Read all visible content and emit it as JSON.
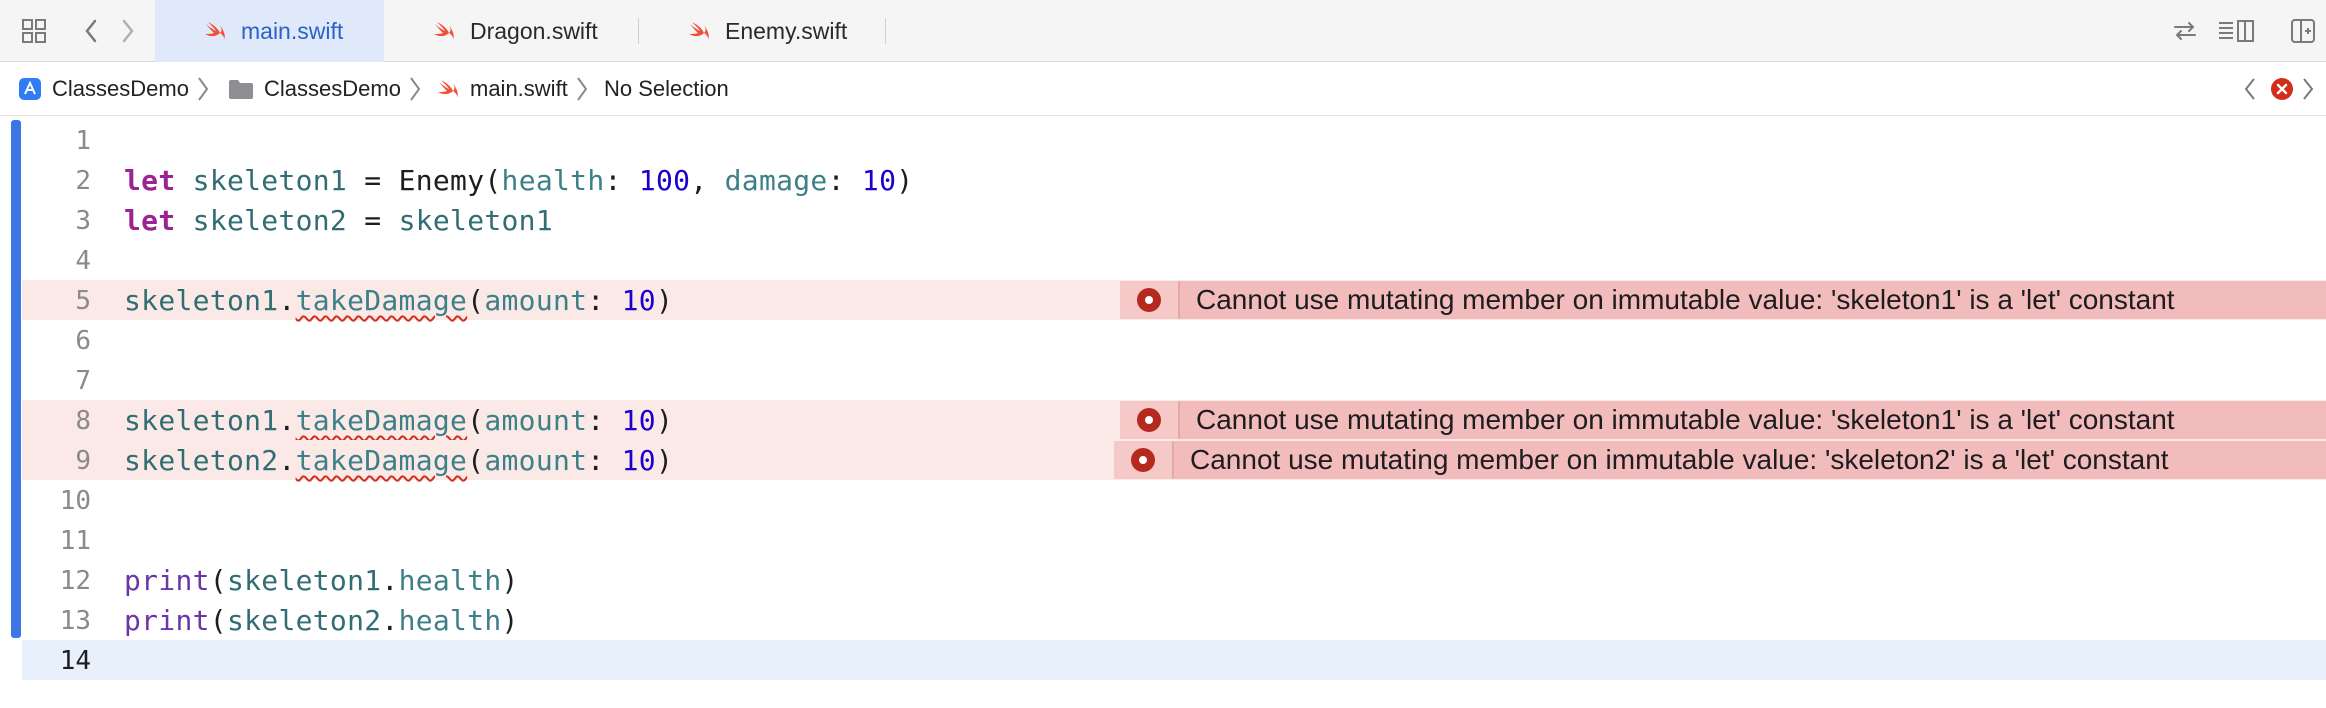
{
  "tabs": [
    {
      "label": "main.swift",
      "active": true
    },
    {
      "label": "Dragon.swift",
      "active": false
    },
    {
      "label": "Enemy.swift",
      "active": false
    }
  ],
  "breadcrumb": {
    "project": "ClassesDemo",
    "folder": "ClassesDemo",
    "file": "main.swift",
    "symbol": "No Selection"
  },
  "lines": [
    {
      "n": "1"
    },
    {
      "n": "2"
    },
    {
      "n": "3"
    },
    {
      "n": "4"
    },
    {
      "n": "5"
    },
    {
      "n": "6"
    },
    {
      "n": "7"
    },
    {
      "n": "8"
    },
    {
      "n": "9"
    },
    {
      "n": "10"
    },
    {
      "n": "11"
    },
    {
      "n": "12"
    },
    {
      "n": "13"
    },
    {
      "n": "14"
    }
  ],
  "code": {
    "l2": {
      "kw": "let",
      "name": "skeleton1",
      "eq": " = ",
      "type": "Enemy",
      "p1": "health",
      "v1": "100",
      "p2": "damage",
      "v2": "10"
    },
    "l3": {
      "kw": "let",
      "name": "skeleton2",
      "eq": " = ",
      "rhs": "skeleton1"
    },
    "l5": {
      "obj": "skeleton1",
      "method": "takeDamage",
      "arg": "amount",
      "val": "10"
    },
    "l8": {
      "obj": "skeleton1",
      "method": "takeDamage",
      "arg": "amount",
      "val": "10"
    },
    "l9": {
      "obj": "skeleton2",
      "method": "takeDamage",
      "arg": "amount",
      "val": "10"
    },
    "l12": {
      "fn": "print",
      "obj": "skeleton1",
      "prop": "health"
    },
    "l13": {
      "fn": "print",
      "obj": "skeleton2",
      "prop": "health"
    }
  },
  "errors": {
    "e5": "Cannot use mutating member on immutable value: 'skeleton1' is a 'let' constant",
    "e8": "Cannot use mutating member on immutable value: 'skeleton1' is a 'let' constant",
    "e9": "Cannot use mutating member on immutable value: 'skeleton2' is a 'let' constant"
  },
  "colors": {
    "accent": "#3b76e4",
    "error_line": "#fbe9e8",
    "error_annotation": "#f3bcbc",
    "error_badge": "#b52a1f"
  },
  "icons": {
    "grid": "grid-icon",
    "back": "chevron-left-icon",
    "forward": "chevron-right-icon",
    "swift": "swift-icon",
    "app": "app-icon",
    "folder": "folder-icon",
    "error": "error-icon",
    "swap": "swap-icon",
    "inspector": "inspector-icon",
    "add_editor": "add-editor-icon"
  }
}
